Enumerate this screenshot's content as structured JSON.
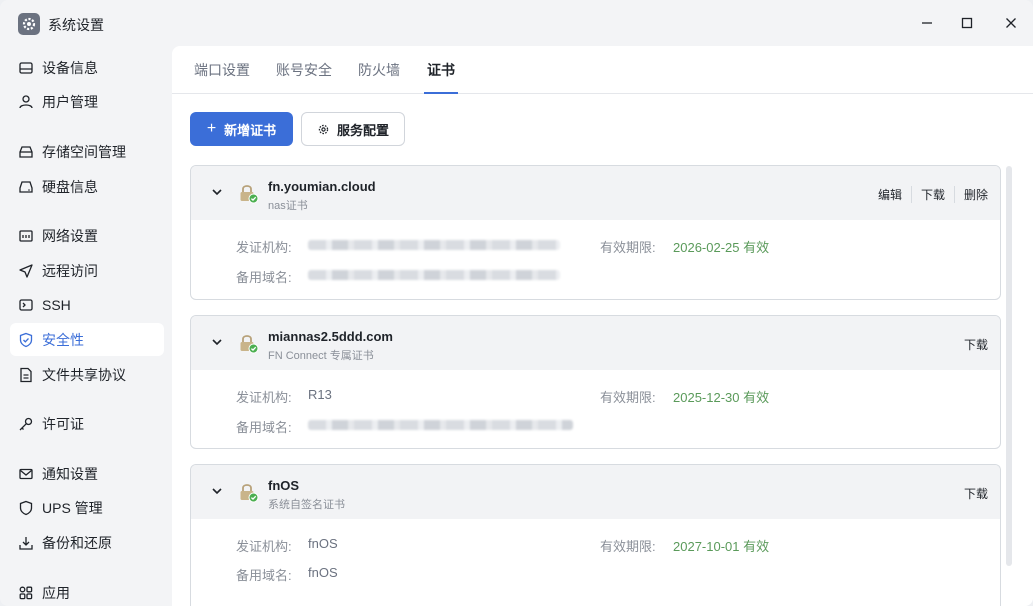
{
  "window": {
    "title": "系统设置"
  },
  "sidebar": {
    "items": [
      {
        "label": "设备信息",
        "icon": "device-icon"
      },
      {
        "label": "用户管理",
        "icon": "user-icon"
      },
      {
        "label": "存储空间管理",
        "icon": "storage-icon"
      },
      {
        "label": "硬盘信息",
        "icon": "disk-icon"
      },
      {
        "label": "网络设置",
        "icon": "network-icon"
      },
      {
        "label": "远程访问",
        "icon": "send-icon"
      },
      {
        "label": "SSH",
        "icon": "terminal-icon"
      },
      {
        "label": "安全性",
        "icon": "shield-check-icon",
        "active": true
      },
      {
        "label": "文件共享协议",
        "icon": "file-icon"
      },
      {
        "label": "许可证",
        "icon": "key-icon"
      },
      {
        "label": "通知设置",
        "icon": "mail-icon"
      },
      {
        "label": "UPS 管理",
        "icon": "shield-icon"
      },
      {
        "label": "备份和还原",
        "icon": "download-icon"
      },
      {
        "label": "应用",
        "icon": "apps-icon"
      }
    ]
  },
  "tabs": [
    {
      "label": "端口设置"
    },
    {
      "label": "账号安全"
    },
    {
      "label": "防火墙"
    },
    {
      "label": "证书",
      "active": true
    }
  ],
  "toolbar": {
    "add_label": "新增证书",
    "service_label": "服务配置"
  },
  "labels": {
    "issuer": "发证机构:",
    "validity": "有效期限:",
    "alt_domain": "备用域名:"
  },
  "certificates": [
    {
      "name": "fn.youmian.cloud",
      "subtitle": "nas证书",
      "actions": [
        "编辑",
        "下载",
        "删除"
      ],
      "issuer": "",
      "validity": "2026-02-25 有效",
      "alt_domain": ""
    },
    {
      "name": "miannas2.5ddd.com",
      "subtitle": "FN Connect 专属证书",
      "actions": [
        "下载"
      ],
      "issuer": "R13",
      "validity": "2025-12-30 有效",
      "alt_domain": ""
    },
    {
      "name": "fnOS",
      "subtitle": "系统自签名证书",
      "actions": [
        "下载"
      ],
      "issuer": "fnOS",
      "validity": "2027-10-01 有效",
      "alt_domain": "fnOS"
    }
  ],
  "colors": {
    "accent": "#3b6ed8",
    "valid": "#5a9a5a"
  }
}
